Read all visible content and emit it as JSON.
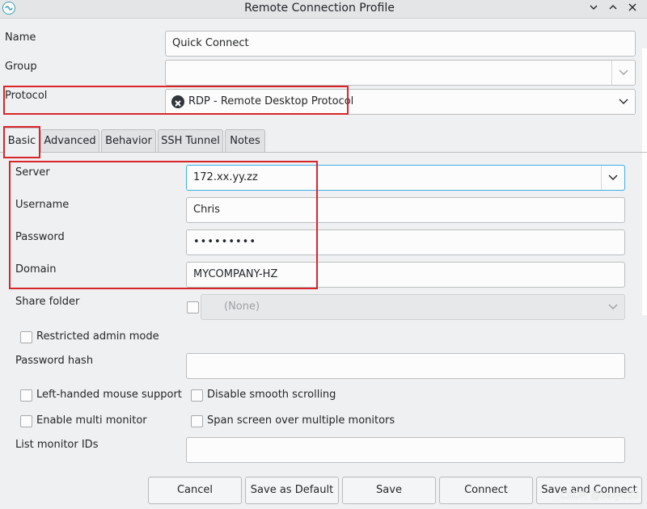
{
  "window": {
    "title": "Remote Connection Profile"
  },
  "form": {
    "name_label": "Name",
    "name_value": "Quick Connect",
    "group_label": "Group",
    "group_value": "",
    "protocol_label": "Protocol",
    "protocol_value": "RDP - Remote Desktop Protocol"
  },
  "tabs": [
    {
      "label": "Basic",
      "active": true
    },
    {
      "label": "Advanced",
      "active": false
    },
    {
      "label": "Behavior",
      "active": false
    },
    {
      "label": "SSH Tunnel",
      "active": false
    },
    {
      "label": "Notes",
      "active": false
    }
  ],
  "basic": {
    "server_label": "Server",
    "server_value": "172.xx.yy.zz",
    "username_label": "Username",
    "username_value": "Chris",
    "password_label": "Password",
    "password_value": "•••••••••",
    "domain_label": "Domain",
    "domain_value": "MYCOMPANY-HZ",
    "share_folder_label": "Share folder",
    "share_folder_value": "(None)",
    "restricted_admin_label": "Restricted admin mode",
    "password_hash_label": "Password hash",
    "password_hash_value": "",
    "left_handed_label": "Left-handed mouse support",
    "disable_smooth_label": "Disable smooth scrolling",
    "multi_monitor_label": "Enable multi monitor",
    "span_screen_label": "Span screen over multiple monitors",
    "monitor_ids_label": "List monitor IDs",
    "monitor_ids_value": ""
  },
  "buttons": {
    "cancel": "Cancel",
    "save_default": "Save as Default",
    "save": "Save",
    "connect": "Connect",
    "save_connect": "Save and Connect"
  },
  "watermark": "CSDN @baiyu33",
  "colors": {
    "annotation_red": "#d9252a",
    "focus_blue": "#3daee9",
    "window_bg": "#eff0f1"
  }
}
